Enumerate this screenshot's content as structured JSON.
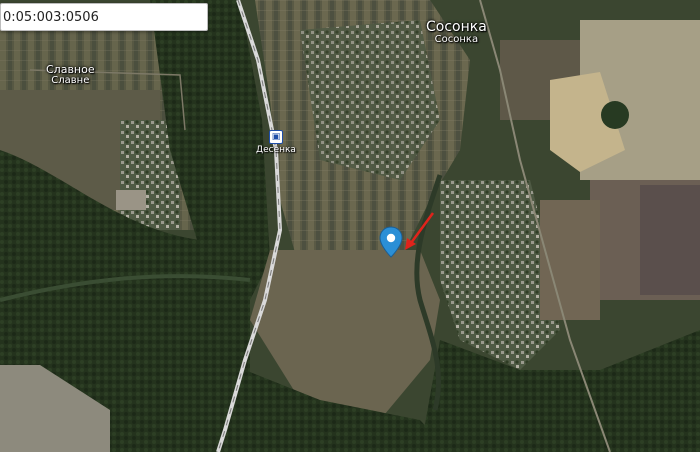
{
  "search": {
    "value": "0:05:003:0506"
  },
  "labels": {
    "sosonka_ru": "Сосонка",
    "sosonka_uk": "Сосонка",
    "slavnoe_ru": "Славное",
    "slavnoe_uk": "Славне",
    "desenka": "Десенка"
  },
  "colors": {
    "pin": "#2b8fd6",
    "arrow": "#e0231b",
    "railway": "#d9d9d9"
  },
  "icons": {
    "station": "railway-station-icon",
    "pin": "map-pin-icon",
    "arrow": "red-arrow-annotation"
  }
}
